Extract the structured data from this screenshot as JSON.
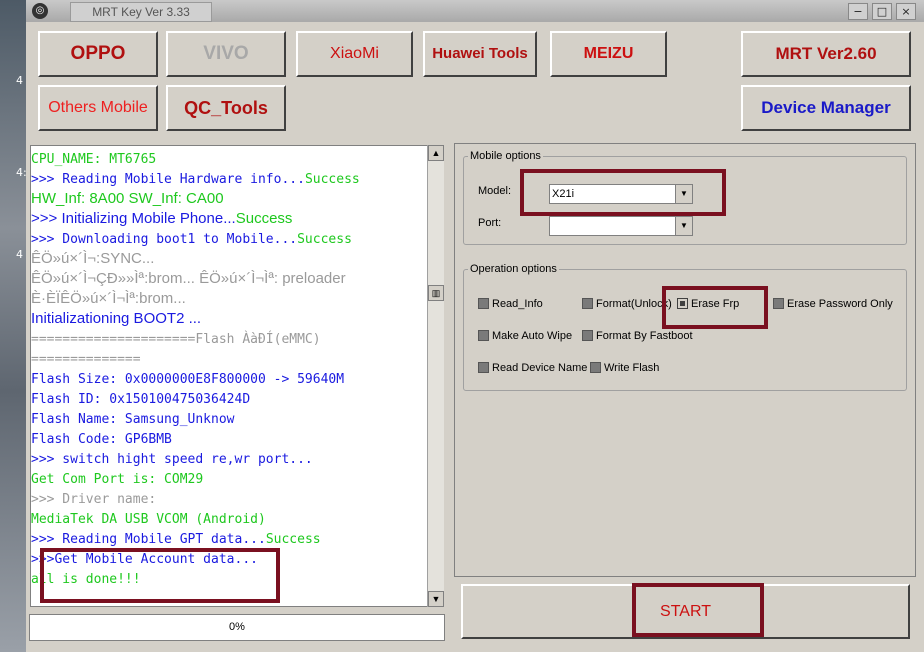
{
  "window": {
    "title": "MRT Key Ver 3.33",
    "icon": "app-icon",
    "controls": {
      "minimize": "−",
      "maximize": "□",
      "close": "×"
    }
  },
  "desktop_glyphs": [
    "4",
    "4:",
    "4"
  ],
  "brand_buttons": [
    {
      "label": "OPPO",
      "color": "#b01010",
      "enabled": true
    },
    {
      "label": "VIVO",
      "color": "#a8a8a8",
      "enabled": false
    },
    {
      "label": "XiaoMi",
      "color": "#cc1010",
      "enabled": true
    },
    {
      "label": "Huawei Tools",
      "color": "#b01010",
      "enabled": true
    },
    {
      "label": "MEIZU",
      "color": "#cc1010",
      "enabled": true
    },
    {
      "label": "MRT Ver2.60",
      "color": "#b01010",
      "enabled": true
    },
    {
      "label": "Others Mobile",
      "color": "#ee2020",
      "enabled": true
    },
    {
      "label": "QC_Tools",
      "color": "#b01010",
      "enabled": true
    },
    {
      "label": "Device Manager",
      "color": "#1a1ac8",
      "enabled": true
    }
  ],
  "log": [
    {
      "segments": [
        {
          "text": "    CPU_NAME: MT6765",
          "color": "green",
          "font": "mono"
        }
      ]
    },
    {
      "segments": [
        {
          "text": ">>> Reading Mobile Hardware info...",
          "color": "blue",
          "font": "mono"
        },
        {
          "text": "Success",
          "color": "green",
          "font": "mono"
        }
      ]
    },
    {
      "segments": [
        {
          "text": "    HW_Inf: 8A00  SW_Inf: CA00",
          "color": "green",
          "font": "sans"
        }
      ]
    },
    {
      "segments": [
        {
          "text": ">>> Initializing Mobile Phone...",
          "color": "blue",
          "font": "sans"
        },
        {
          "text": "Success",
          "color": "green",
          "font": "sans"
        }
      ]
    },
    {
      "segments": [
        {
          "text": ">>> Downloading boot1 to Mobile...",
          "color": "blue",
          "font": "mono"
        },
        {
          "text": "Success",
          "color": "green",
          "font": "mono"
        }
      ]
    },
    {
      "segments": [
        {
          "text": "    ÊÖ»ú×´Ì¬:SYNC...",
          "color": "gray",
          "font": "sans"
        }
      ]
    },
    {
      "segments": [
        {
          "text": "    ÊÖ»ú×´Ì¬ÇÐ»»Ìª:brom...   ÊÖ»ú×´Ì¬Ìª: preloader",
          "color": "gray",
          "font": "sans"
        }
      ]
    },
    {
      "segments": [
        {
          "text": "    È·ÈÏÊÖ»ú×´Ì¬Ìª:brom...",
          "color": "gray",
          "font": "sans"
        }
      ]
    },
    {
      "segments": [
        {
          "text": "  Initializationing BOOT2 ...",
          "color": "blue",
          "font": "sans"
        }
      ]
    },
    {
      "segments": [
        {
          "text": "    =====================Flash ÀàÐÍ(eMMC)",
          "color": "gray",
          "font": "mono"
        }
      ]
    },
    {
      "segments": [
        {
          "text": "==============",
          "color": "gray",
          "font": "mono"
        }
      ]
    },
    {
      "segments": [
        {
          "text": "    Flash Size: 0x0000000E8F800000 -> 59640M",
          "color": "blue",
          "font": "mono"
        }
      ]
    },
    {
      "segments": [
        {
          "text": "    Flash  ID: 0x150100475036424D",
          "color": "blue",
          "font": "mono"
        }
      ]
    },
    {
      "segments": [
        {
          "text": "    Flash Name: Samsung_Unknow",
          "color": "blue",
          "font": "mono"
        }
      ]
    },
    {
      "segments": [
        {
          "text": "    Flash Code: GP6BMB",
          "color": "blue",
          "font": "mono"
        }
      ]
    },
    {
      "segments": [
        {
          "text": ">>> switch hight speed re,wr port...",
          "color": "blue",
          "font": "mono"
        }
      ]
    },
    {
      "segments": [
        {
          "text": "    Get Com Port is:  COM29",
          "color": "green",
          "font": "mono"
        }
      ]
    },
    {
      "segments": [
        {
          "text": ">>> Driver name:",
          "color": "gray",
          "font": "mono"
        }
      ]
    },
    {
      "segments": [
        {
          "text": "    MediaTek DA USB VCOM (Android)",
          "color": "green",
          "font": "mono"
        }
      ]
    },
    {
      "segments": [
        {
          "text": ">>> Reading Mobile GPT data...",
          "color": "blue",
          "font": "mono"
        },
        {
          "text": "Success",
          "color": "green",
          "font": "mono"
        }
      ]
    },
    {
      "segments": [
        {
          "text": ">>>Get Mobile Account data...",
          "color": "blue",
          "font": "mono"
        }
      ]
    },
    {
      "segments": [
        {
          "text": "    all is done!!!",
          "color": "green",
          "font": "mono"
        }
      ]
    }
  ],
  "progress": {
    "label": "0%",
    "value": 0
  },
  "mobile_options": {
    "legend": "Mobile options",
    "model_label": "Model:",
    "model_value": "X21i",
    "port_label": "Port:",
    "port_value": ""
  },
  "operation_options": {
    "legend": "Operation options",
    "items": [
      {
        "label": "Read_Info",
        "checked": false
      },
      {
        "label": "Format(Unlock)",
        "checked": false
      },
      {
        "label": "Erase Frp",
        "checked": true
      },
      {
        "label": "Erase Password Only",
        "checked": false
      },
      {
        "label": "Make Auto Wipe",
        "checked": false
      },
      {
        "label": "Format By Fastboot",
        "checked": false
      },
      {
        "label": "Read Device Name",
        "checked": false
      },
      {
        "label": "Write Flash",
        "checked": false
      }
    ]
  },
  "start_button": {
    "label": "START"
  },
  "colors": {
    "highlight": "#7a1020",
    "blue": "#1a1ae0",
    "green": "#1ec81e",
    "gray": "#9a9a9a"
  }
}
